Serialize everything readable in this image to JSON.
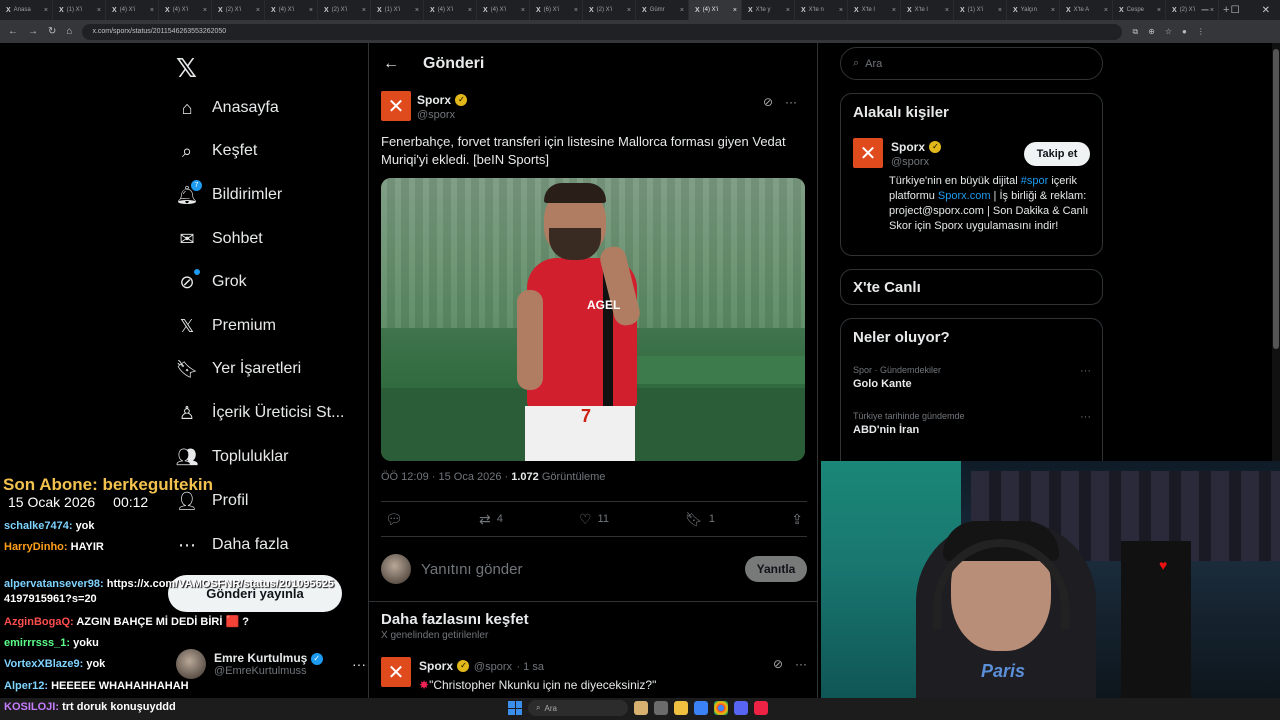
{
  "browser": {
    "tabs": [
      "Anasa",
      "(1) X'i",
      "(4) X'i",
      "(4) X'i",
      "(2) X'i",
      "(4) X'i",
      "(2) X'i",
      "(1) X'i",
      "(4) X'i",
      "(4) X'i",
      "(6) X'i",
      "(2) X'i",
      "Gümr",
      "(4) X'i",
      "X'te y",
      "X'te n",
      "X'te l",
      "X'te l",
      "(1) X'i",
      "Yalçın",
      "X'te A",
      "Cespe",
      "(2) X'i"
    ],
    "active_tab": 13,
    "url": "x.com/sporx/status/2011546263553262050"
  },
  "nav": {
    "items": [
      {
        "label": "Anasayfa",
        "icon": "home-icon"
      },
      {
        "label": "Keşfet",
        "icon": "search-icon"
      },
      {
        "label": "Bildirimler",
        "icon": "bell-icon",
        "badge": "7"
      },
      {
        "label": "Sohbet",
        "icon": "mail-icon"
      },
      {
        "label": "Grok",
        "icon": "grok-icon"
      },
      {
        "label": "Premium",
        "icon": "x-logo-icon"
      },
      {
        "label": "Yer İşaretleri",
        "icon": "bookmark-icon"
      },
      {
        "label": "İçerik Üreticisi St...",
        "icon": "creator-icon"
      },
      {
        "label": "Topluluklar",
        "icon": "communities-icon"
      },
      {
        "label": "Profil",
        "icon": "profile-icon"
      },
      {
        "label": "Daha fazla",
        "icon": "more-icon"
      }
    ],
    "post_button": "Gönderi yayınla",
    "account": {
      "name": "Emre Kurtulmuş",
      "handle": "@EmreKurtulmuss"
    }
  },
  "main": {
    "header": "Gönderi",
    "post": {
      "author": "Sporx",
      "handle": "@sporx",
      "text": "Fenerbahçe, forvet transferi için listesine Mallorca forması giyen Vedat Muriqi'yi ekledi. [beIN Sports]",
      "time": "ÖÖ 12:09 · 15 Oca 2026 · ",
      "views": "1.072",
      "views_label": " Görüntüleme",
      "retweets": "4",
      "likes": "11",
      "bookmarks": "1",
      "photo_sponsor": "AGEL",
      "photo_number": "7"
    },
    "reply_placeholder": "Yanıtını gönder",
    "reply_button": "Yanıtla",
    "more_title": "Daha fazlasını keşfet",
    "more_sub": "X genelinden getirilenler",
    "next_post": {
      "author": "Sporx",
      "handle": "@sporx",
      "time": "· 1 sa",
      "text": "\"Christopher Nkunku için ne diyeceksiniz?\""
    }
  },
  "right": {
    "search_placeholder": "Ara",
    "related_title": "Alakalı kişiler",
    "related": {
      "name": "Sporx",
      "handle": "@sporx",
      "follow": "Takip et",
      "bio_1": "Türkiye'nin en büyük dijital ",
      "bio_hashtag": "#spor",
      "bio_2": " içerik platformu ",
      "bio_link": "Sporx.com",
      "bio_3": " | İş birliği & reklam: project@sporx.com | Son Dakika & Canlı Skor için Sporx uygulamasını indir!"
    },
    "live_title": "X'te Canlı",
    "trends_title": "Neler oluyor?",
    "trends": [
      {
        "context": "Spor · Gündemdekiler",
        "name": "Golo Kante"
      },
      {
        "context": "Türkiye tarihinde gündemde",
        "name": "ABD'nin İran"
      }
    ]
  },
  "overlay": {
    "last_sub": "Son Abone: berkegultekin",
    "date": "15 Ocak 2026",
    "time": "00:12",
    "chat": [
      {
        "user": "schalke7474:",
        "msg": "yok",
        "color": "#7fd3ff"
      },
      {
        "user": "HarryDinho:",
        "msg": "HAYIR",
        "color": "#ff9f1a"
      },
      {
        "user": "alpervatansever98:",
        "msg": "https://x.com/VAMOSFNR/status/201095625 4197915961?s=20",
        "color": "#7fd3ff"
      },
      {
        "user": "AzginBogaQ:",
        "msg": "AZGIN BAHÇE Mİ DEDİ BİRİ 🟥 ?",
        "color": "#ff4d4d"
      },
      {
        "user": "emirrrsss_1:",
        "msg": "yoku",
        "color": "#5cff8a"
      },
      {
        "user": "VortexXBlaze9:",
        "msg": "yok",
        "color": "#7fd3ff"
      },
      {
        "user": "Alper12:",
        "msg": "HEEEEE WHAHAHHAHAH",
        "color": "#7fd3ff"
      },
      {
        "user": "KOSILOJI:",
        "msg": "trt doruk konuşuyddd",
        "color": "#c77dff"
      }
    ]
  },
  "webcam": {
    "shirt_text": "Paris"
  },
  "taskbar": {
    "search": "Ara"
  }
}
